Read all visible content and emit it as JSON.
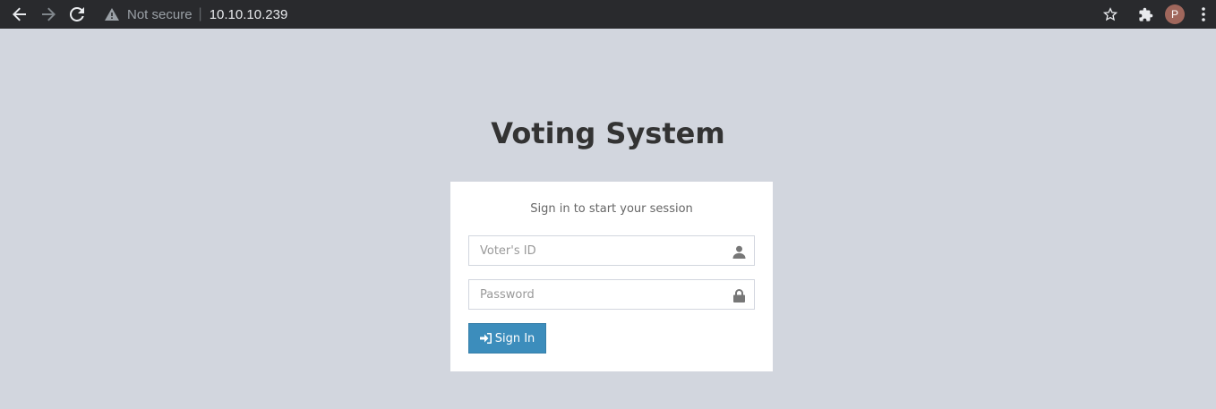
{
  "browser": {
    "security_label": "Not secure",
    "separator": "|",
    "url": "10.10.10.239",
    "profile_initial": "P"
  },
  "page": {
    "title": "Voting System",
    "login_message": "Sign in to start your session",
    "voter_id_placeholder": "Voter's ID",
    "password_placeholder": "Password",
    "signin_label": "Sign In"
  },
  "colors": {
    "background": "#d2d6de",
    "primary_button": "#3c8dbc",
    "browser_bar": "#292a2d"
  }
}
